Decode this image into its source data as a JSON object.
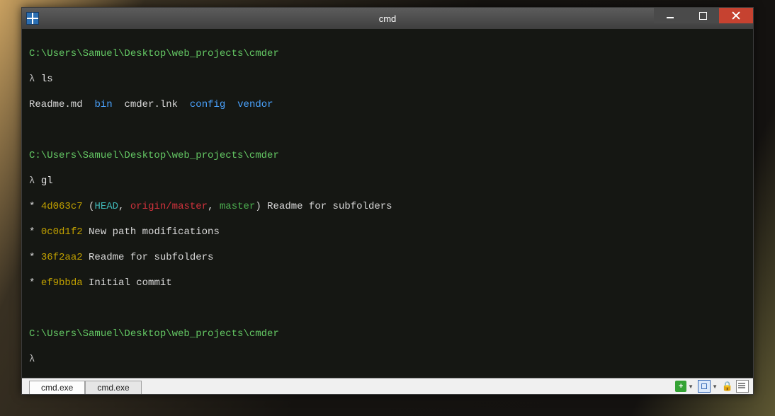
{
  "window": {
    "title": "cmd"
  },
  "terminal": {
    "prompts": [
      {
        "path": "C:\\Users\\Samuel\\Desktop\\web_projects\\cmder",
        "symbol": "λ",
        "input": "ls"
      },
      {
        "path": "C:\\Users\\Samuel\\Desktop\\web_projects\\cmder",
        "symbol": "λ",
        "input": "gl"
      },
      {
        "path": "C:\\Users\\Samuel\\Desktop\\web_projects\\cmder",
        "symbol": "λ",
        "input": ""
      }
    ],
    "ls_output": {
      "entries": [
        {
          "name": "Readme.md",
          "type": "file"
        },
        {
          "name": "bin",
          "type": "dir"
        },
        {
          "name": "cmder.lnk",
          "type": "file"
        },
        {
          "name": "config",
          "type": "dir"
        },
        {
          "name": "vendor",
          "type": "dir"
        }
      ]
    },
    "git_log": [
      {
        "star": "*",
        "hash": "4d063c7",
        "decor": {
          "open": "(",
          "head": "HEAD",
          "sep1": ", ",
          "remote": "origin/master",
          "sep2": ", ",
          "branch": "master",
          "close": ")"
        },
        "message": "Readme for subfolders"
      },
      {
        "star": "*",
        "hash": "0c0d1f2",
        "message": "New path modifications"
      },
      {
        "star": "*",
        "hash": "36f2aa2",
        "message": "Readme for subfolders"
      },
      {
        "star": "*",
        "hash": "ef9bbda",
        "message": "Initial commit"
      }
    ]
  },
  "statusbar": {
    "tabs": [
      {
        "label": "cmd.exe",
        "active": true
      },
      {
        "label": "cmd.exe",
        "active": false
      }
    ],
    "icons": {
      "plus_tooltip": "New console",
      "windows_tooltip": "Attach",
      "lock_tooltip": "Lock",
      "menu_tooltip": "Menu"
    }
  }
}
